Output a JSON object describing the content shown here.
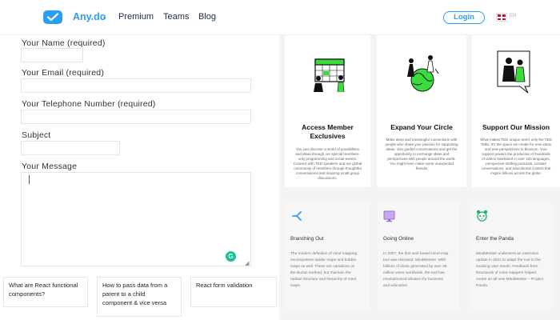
{
  "header": {
    "brand": "Any.do",
    "brand_chevron": "⌄",
    "nav": [
      "Premium",
      "Teams",
      "Blog"
    ],
    "login": "Login",
    "lang": "EN"
  },
  "form": {
    "name_label": "Your Name (required)",
    "email_label": "Your Email (required)",
    "phone_label": "Your Telephone Number (required)",
    "subject_label": "Subject",
    "message_label": "Your Message",
    "grammarly": "G"
  },
  "related": [
    "What are React functional components?",
    "How to pass data from a parent to a child component & vice versa",
    "React form validation"
  ],
  "cards": [
    {
      "title": "Access Member Exclusives",
      "body": "You can discover a world of possibilities and ideas through our special members-only programming and social events. Connect with TED speakers and our global community of members through thoughtful conversations and inspiring small group discussions."
    },
    {
      "title": "Expand Your Circle",
      "body": "Make deep and meaningful connections with people who share your passion for supporting ideas. Join guided conversations and get the opportunity to exchange ideas and perspectives with people around the world. You might even make some unexpected friends!"
    },
    {
      "title": "Support Our Mission",
      "body": "What makes TED unique aren't only the TED Talks. It's the space we create for new ideas and new perspectives to blossom. Your support powers the production of hundreds of videos translated in over 100 languages, perspective-shifting podcasts, curated conversations, and educational content that inspire billions across the globe."
    }
  ],
  "features": [
    {
      "title": "Branching Out",
      "icon": "branch-icon",
      "body": "The modern definition of mind mapping encompasses spider maps and bubble maps as well. These are variations on the Buzan method, but maintain the radiant structure and hierarchy of mind maps."
    },
    {
      "title": "Going Online",
      "icon": "monitor-icon",
      "body": "In 2007, the first web based mind map tool was released: MindMeister. With billions of ideas generated by over 25 million users worldwide, the tool has revolutionized ideation for business and education."
    },
    {
      "title": "Enter the Panda",
      "icon": "panda-icon",
      "body": "MindMeister underwent an extensive update in 2021 to adapt the tool to the evolving user needs. Feedback from thousands of mind mappers helped create an all new MindMeister – Project Panda."
    }
  ],
  "colors": {
    "brand": "#2a9df4",
    "accent_green": "#3ddc3d",
    "feature_icon_blue": "#2a9df4",
    "feature_icon_purple": "#a06ad8",
    "feature_icon_green": "#23b26d"
  }
}
